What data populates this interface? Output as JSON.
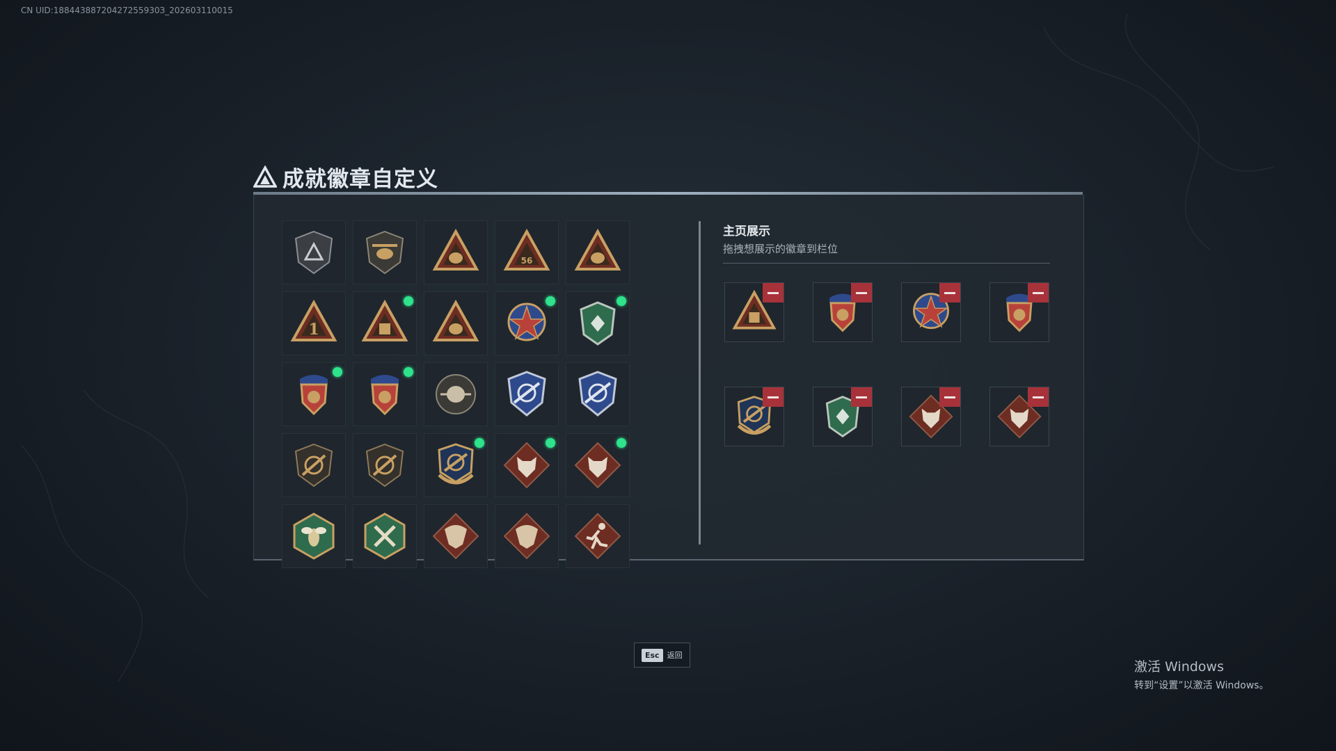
{
  "uid_text": "CN UID:18844388720427255930З_202603110015",
  "header": {
    "title": "成就徽章自定义",
    "logo_icon": "delta-logo-icon"
  },
  "badge_grid": [
    {
      "icon": "shield-delta-badge",
      "new": false
    },
    {
      "icon": "helicopter-badge",
      "new": false
    },
    {
      "icon": "triangle-serpent-badge",
      "new": false
    },
    {
      "icon": "triangle-56-badge",
      "new": false
    },
    {
      "icon": "triangle-wings-badge",
      "new": false
    },
    {
      "icon": "triangle-number-one-badge",
      "new": false
    },
    {
      "icon": "triangle-crate-badge",
      "new": true
    },
    {
      "icon": "triangle-soldier-badge",
      "new": false
    },
    {
      "icon": "red-star-medal-badge",
      "new": true
    },
    {
      "icon": "green-emblem-badge",
      "new": true
    },
    {
      "icon": "red-crest-badge",
      "new": true
    },
    {
      "icon": "red-crest-badge-2",
      "new": true
    },
    {
      "icon": "round-skull-badge",
      "new": false
    },
    {
      "icon": "blue-rifle-shield-badge",
      "new": false
    },
    {
      "icon": "blue-rifle-shield-badge-2",
      "new": false
    },
    {
      "icon": "dark-rifle-shield-badge",
      "new": false
    },
    {
      "icon": "dark-rifle-shield-badge-2",
      "new": false
    },
    {
      "icon": "gold-rifle-shield-badge",
      "new": true
    },
    {
      "icon": "wolf-diamond-badge",
      "new": true
    },
    {
      "icon": "wolf-diamond-badge-2",
      "new": true
    },
    {
      "icon": "bee-hexagon-badge",
      "new": false
    },
    {
      "icon": "tools-hexagon-badge",
      "new": false
    },
    {
      "icon": "dragon-diamond-badge",
      "new": false
    },
    {
      "icon": "dragon-diamond-badge-2",
      "new": false
    },
    {
      "icon": "runner-diamond-badge",
      "new": false
    }
  ],
  "showcase": {
    "title": "主页展示",
    "subtitle": "拖拽想展示的徽章到栏位",
    "slots": [
      {
        "icon": "triangle-crate-badge"
      },
      {
        "icon": "red-crest-badge"
      },
      {
        "icon": "red-star-medal-badge"
      },
      {
        "icon": "red-crest-badge-2"
      },
      {
        "icon": "gold-rifle-shield-badge"
      },
      {
        "icon": "green-emblem-badge"
      },
      {
        "icon": "wolf-diamond-badge"
      },
      {
        "icon": "wolf-diamond-badge-2"
      }
    ]
  },
  "footer": {
    "key": "Esc",
    "label": "返回"
  },
  "watermark": {
    "line1": "激活 Windows",
    "line2": "转到“设置”以激活 Windows。"
  },
  "colors": {
    "new_dot": "#2ee38c",
    "remove_button": "#a8323a",
    "gold": "#c8a063",
    "maroon": "#6e2d22"
  }
}
